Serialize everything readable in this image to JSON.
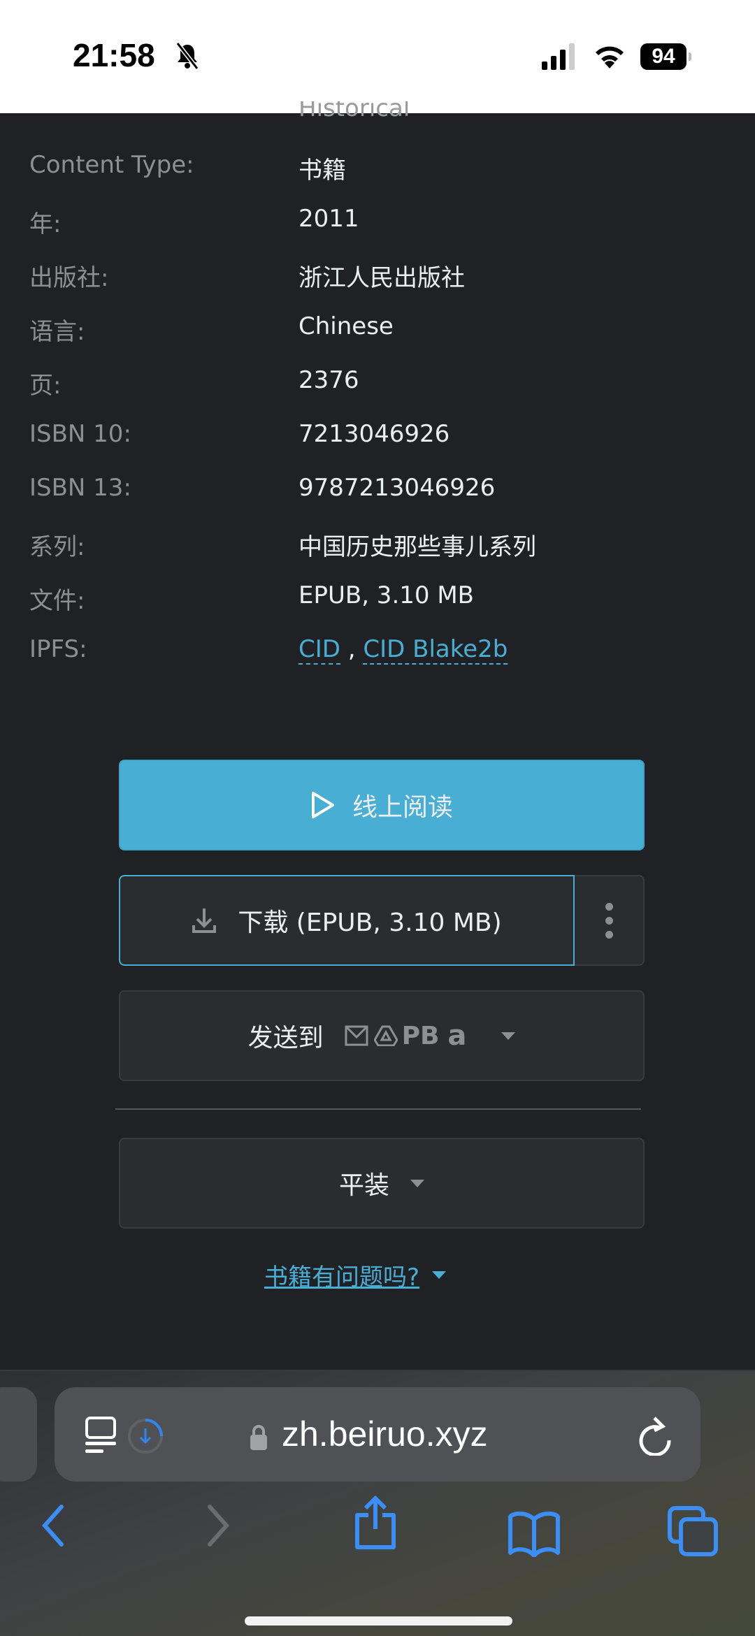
{
  "status_bar": {
    "time": "21:58",
    "battery": "94"
  },
  "details": {
    "partial_link": "Historical",
    "rows": [
      {
        "label": "Content Type:",
        "value": "书籍"
      },
      {
        "label": "年:",
        "value": "2011"
      },
      {
        "label": "出版社:",
        "value": "浙江人民出版社"
      },
      {
        "label": "语言:",
        "value": "Chinese"
      },
      {
        "label": "页:",
        "value": "2376"
      },
      {
        "label": "ISBN 10:",
        "value": "7213046926"
      },
      {
        "label": "ISBN 13:",
        "value": "9787213046926"
      },
      {
        "label": "系列:",
        "value": "中国历史那些事儿系列"
      },
      {
        "label": "文件:",
        "value": "EPUB, 3.10 MB"
      }
    ],
    "ipfs": {
      "label": "IPFS:",
      "link1": "CID",
      "sep": ",",
      "link2": "CID Blake2b"
    }
  },
  "actions": {
    "read_online": "线上阅读",
    "download": "下载 (EPUB, 3.10 MB)",
    "send_to": "发送到",
    "send_pb": "PB",
    "send_amazon": "a",
    "binding": "平装",
    "problem": "书籍有问题吗?"
  },
  "colors": {
    "accent": "#48aed3",
    "background": "#202124"
  },
  "browser": {
    "url": "zh.beiruo.xyz"
  }
}
